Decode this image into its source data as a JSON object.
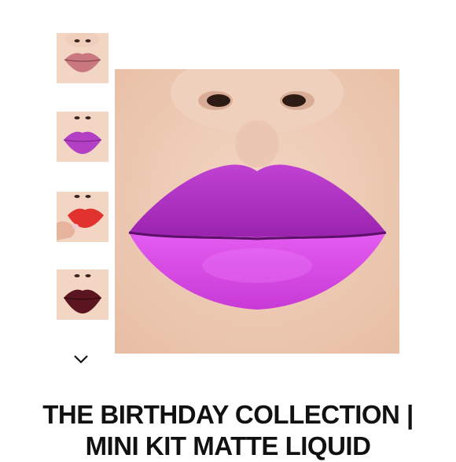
{
  "gallery": {
    "thumbnails": [
      {
        "shade_color": "#c8787e",
        "alt": "nude-rose"
      },
      {
        "shade_color": "#b23fc4",
        "alt": "purple"
      },
      {
        "shade_color": "#e1322e",
        "alt": "red"
      },
      {
        "shade_color": "#5a1520",
        "alt": "burgundy"
      }
    ],
    "scroll_icon": "chevron-down-icon"
  },
  "hero": {
    "shade_color": "#c83ad6"
  },
  "product": {
    "title_line1": "THE BIRTHDAY COLLECTION |",
    "title_line2": "MINI KIT MATTE LIQUID"
  }
}
